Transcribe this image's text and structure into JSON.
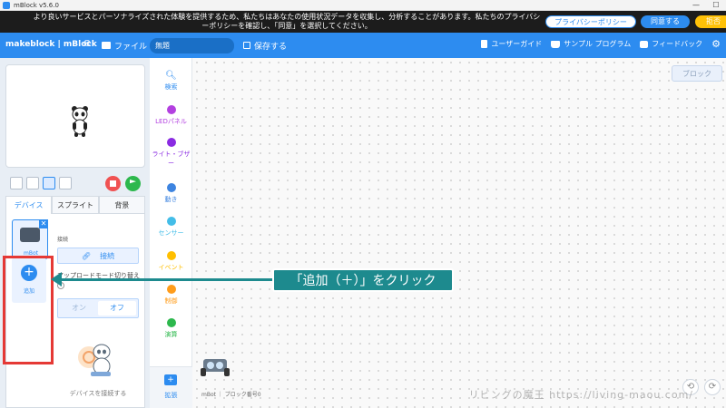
{
  "window": {
    "title": "mBlock v5.6.0",
    "minimize": "—",
    "maximize": "☐"
  },
  "privacy": {
    "message": "より良いサービスとパーソナライズされた体験を提供するため、私たちはあなたの使用状況データを収集し、分析することがあります。私たちのプライバシーポリシーを確認し、「同意」を選択してください。",
    "policy_button": "プライバシーポリシー",
    "agree_button": "同意する",
    "reject_button": "拒否"
  },
  "toolbar": {
    "logo": "makeblock | mBlock",
    "file_menu": "ファイル",
    "project_name": "無題",
    "save_label": "保存する",
    "user_guide": "ユーザーガイド",
    "sample_programs": "サンプル プログラム",
    "feedback": "フィードバック"
  },
  "tabs": [
    {
      "label": "デバイス",
      "active": true
    },
    {
      "label": "スプライト",
      "active": false
    },
    {
      "label": "背景",
      "active": false
    }
  ],
  "device": {
    "name": "mBot",
    "close": "✕"
  },
  "add_button": {
    "plus": "+",
    "label": "追加"
  },
  "connection": {
    "label": "接続",
    "connect_button": "接続",
    "upload_mode_label": "アップロードモード切り替え",
    "help": "?",
    "toggle_off": "オン",
    "toggle_on": "オフ"
  },
  "empty_hint": "デバイスを接続する",
  "categories": [
    {
      "label": "検索",
      "color": "#2d8cf0"
    },
    {
      "label": "LEDパネル",
      "color": "#b340e0"
    },
    {
      "label": "ライト・ブザー",
      "color": "#8a2be2"
    },
    {
      "label": "動き",
      "color": "#3d84e0"
    },
    {
      "label": "センサー",
      "color": "#43bde8"
    },
    {
      "label": "イベント",
      "color": "#ffbf00"
    },
    {
      "label": "制御",
      "color": "#ff9c1a"
    },
    {
      "label": "演算",
      "color": "#2db84d"
    }
  ],
  "extension": {
    "icon": "+",
    "label": "拡張"
  },
  "workspace": {
    "tab": "ブロック",
    "sprite_caption": "mBot ｜ ブロック番号0",
    "zoom_in": "⟲",
    "zoom_out": "⟳"
  },
  "annotation": {
    "callout": "「追加（＋）」をクリック"
  },
  "watermark": "リビングの魔王 https://living-maou.com/",
  "colors": {
    "accent": "#2d8cf0",
    "highlight": "#e53935",
    "callout": "#1d8a8e"
  }
}
